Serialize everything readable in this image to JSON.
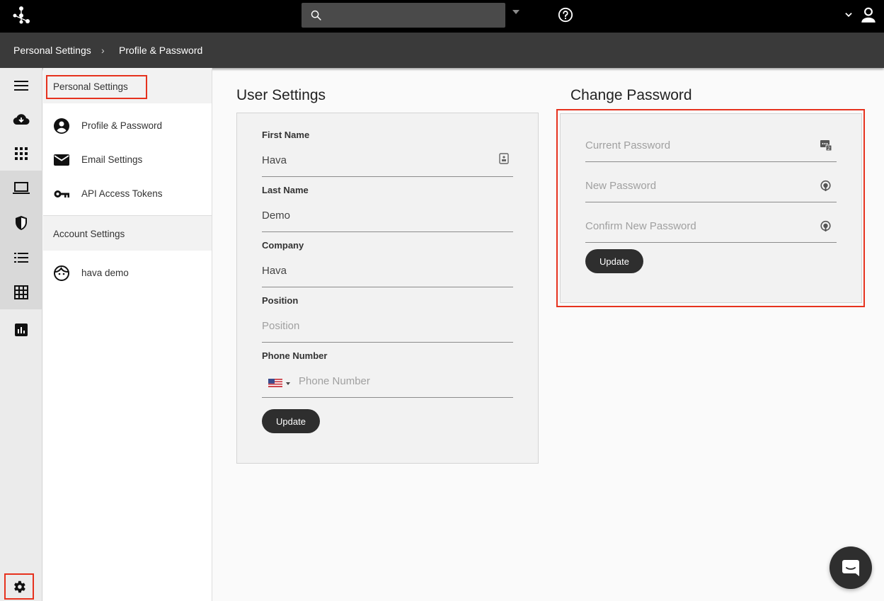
{
  "topbar": {
    "logo_icon": "hava-logo-icon",
    "search": {
      "placeholder": ""
    },
    "help_icon": "help-circle-icon",
    "user_icon": "user-icon"
  },
  "breadcrumb": {
    "items": [
      "Personal Settings",
      "Profile & Password"
    ],
    "separator": "›"
  },
  "rail": {
    "items": [
      "menu-icon",
      "cloud-download-icon",
      "apps-grid-icon",
      "laptop-icon",
      "shield-icon",
      "list-icon",
      "table-grid-icon",
      "bar-chart-icon"
    ],
    "settings_icon": "gear-icon"
  },
  "submenu": {
    "personal_header": "Personal Settings",
    "personal_items": [
      {
        "label": "Profile & Password",
        "icon": "account-circle-icon"
      },
      {
        "label": "Email Settings",
        "icon": "mail-icon"
      },
      {
        "label": "API Access Tokens",
        "icon": "key-icon"
      }
    ],
    "account_header": "Account Settings",
    "account_items": [
      {
        "label": "hava demo",
        "icon": "face-icon"
      }
    ]
  },
  "user_settings": {
    "title": "User Settings",
    "fields": [
      {
        "label": "First Name",
        "value": "Hava",
        "placeholder": ""
      },
      {
        "label": "Last Name",
        "value": "Demo",
        "placeholder": ""
      },
      {
        "label": "Company",
        "value": "Hava",
        "placeholder": ""
      },
      {
        "label": "Position",
        "value": "",
        "placeholder": "Position"
      },
      {
        "label": "Phone Number",
        "value": "",
        "placeholder": "Phone Number"
      }
    ],
    "update_label": "Update"
  },
  "change_password": {
    "title": "Change Password",
    "fields": [
      {
        "placeholder": "Current Password",
        "icon": "password-key-icon"
      },
      {
        "placeholder": "New Password",
        "icon": "lock-pin-icon"
      },
      {
        "placeholder": "Confirm New Password",
        "icon": "lock-pin-icon"
      }
    ],
    "update_label": "Update"
  },
  "colors": {
    "highlight": "#e6321e",
    "topbar": "#000000",
    "breadcrumb": "#3a3a3a",
    "button": "#2e2e2e"
  }
}
